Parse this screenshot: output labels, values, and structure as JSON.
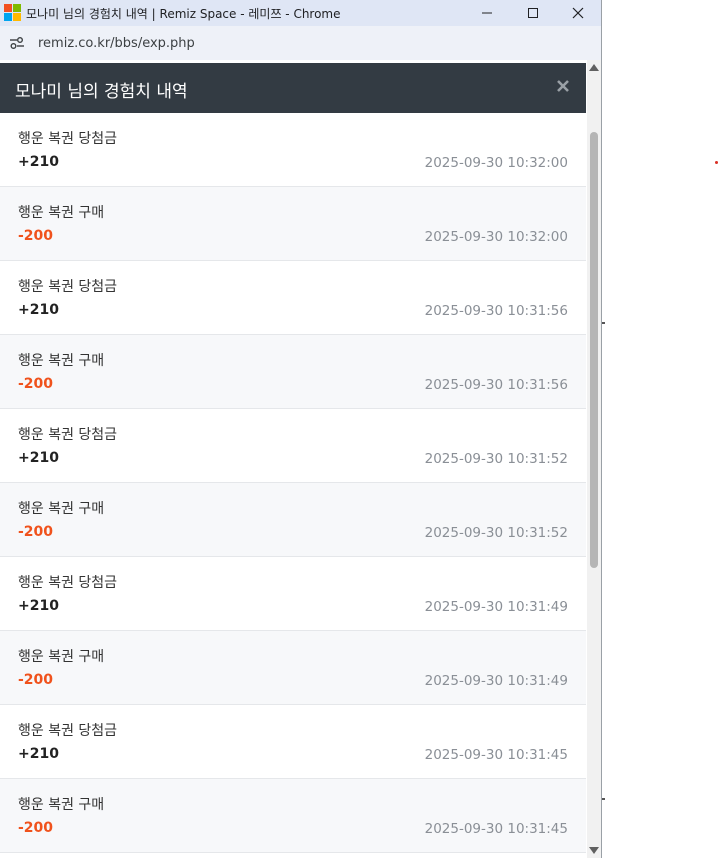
{
  "window": {
    "title": "모나미 님의 경험치 내역 | Remiz Space - 레미쯔 - Chrome",
    "logo_colors": [
      "#f25022",
      "#7fba00",
      "#00a4ef",
      "#ffb900"
    ]
  },
  "browser": {
    "url": "remiz.co.kr/bbs/exp.php"
  },
  "modal": {
    "title": "모나미 님의 경험치 내역"
  },
  "colors": {
    "header_bg": "#333b43",
    "negative": "#f0521c",
    "positive": "#222222"
  },
  "entries": [
    {
      "label": "행운 복권 당첨금",
      "amount": "+210",
      "time": "2025-09-30 10:32:00"
    },
    {
      "label": "행운 복권 구매",
      "amount": "-200",
      "time": "2025-09-30 10:32:00"
    },
    {
      "label": "행운 복권 당첨금",
      "amount": "+210",
      "time": "2025-09-30 10:31:56"
    },
    {
      "label": "행운 복권 구매",
      "amount": "-200",
      "time": "2025-09-30 10:31:56"
    },
    {
      "label": "행운 복권 당첨금",
      "amount": "+210",
      "time": "2025-09-30 10:31:52"
    },
    {
      "label": "행운 복권 구매",
      "amount": "-200",
      "time": "2025-09-30 10:31:52"
    },
    {
      "label": "행운 복권 당첨금",
      "amount": "+210",
      "time": "2025-09-30 10:31:49"
    },
    {
      "label": "행운 복권 구매",
      "amount": "-200",
      "time": "2025-09-30 10:31:49"
    },
    {
      "label": "행운 복권 당첨금",
      "amount": "+210",
      "time": "2025-09-30 10:31:45"
    },
    {
      "label": "행운 복권 구매",
      "amount": "-200",
      "time": "2025-09-30 10:31:45"
    }
  ]
}
